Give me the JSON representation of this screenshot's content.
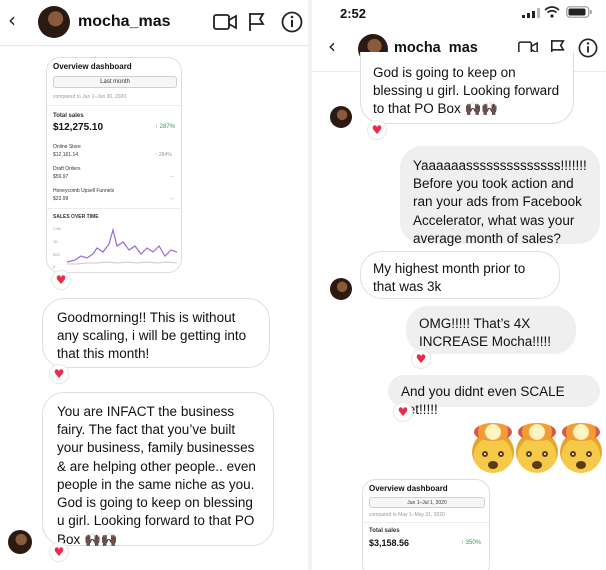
{
  "left": {
    "header": {
      "username": "mocha_mas",
      "back_icon": "chevron-left-icon",
      "icons": [
        "video-call-icon",
        "flag-icon",
        "info-icon"
      ]
    },
    "dashboard_card": {
      "title": "Overview dashboard",
      "date_button": "Last month",
      "compared": "compared to Jun 1–Jun 30, 2020",
      "total_sales_label": "Total sales",
      "total_sales_value": "$12,275.10",
      "total_sales_change": "↑ 287%",
      "rows": [
        {
          "label": "Online Store",
          "value": "$12,161.14",
          "change": "↑ 284%"
        },
        {
          "label": "Draft Orders",
          "value": "$59.97",
          "change": "–"
        },
        {
          "label": "Honeycomb Upsell Funnels",
          "value": "$23.99",
          "change": "–"
        }
      ],
      "chart_title": "SALES OVER TIME",
      "chart_ticks": [
        "1.6K",
        "1K",
        "500",
        "0"
      ]
    },
    "messages": [
      {
        "text": "Goodmorning!! This is without any scaling, i will be getting into that this month!"
      },
      {
        "text": "You are INFACT the business fairy. The fact that you’ve built your business, family businesses & are helping other people.. even people in the same niche as you. God is going to keep on blessing u girl. Looking forward to that PO Box 🙌🏿🙌🏿"
      }
    ]
  },
  "right": {
    "status": {
      "time": "2:52"
    },
    "header": {
      "username": "mocha_mas"
    },
    "messages": [
      {
        "text": "God is going to keep on blessing u girl. Looking forward to that PO Box 🙌🏿🙌🏿"
      },
      {
        "text": "Yaaaaaassssssssssssss!!!!!!! Before you took action and ran your ads from Facebook Accelerator, what was your average month of sales?"
      },
      {
        "text": "My highest month prior to that was 3k"
      },
      {
        "text": "OMG!!!!! That’s 4X INCREASE Mocha!!!!!"
      },
      {
        "text": "And you didnt even SCALE yet!!!!!"
      }
    ],
    "dashboard_card": {
      "title": "Overview dashboard",
      "date_button": "Jun 1–Jul 1, 2020",
      "compared": "compared to May 1–May 31, 2020",
      "total_sales_label": "Total sales",
      "total_sales_value": "$3,158.56",
      "total_sales_change": "↑ 350%"
    }
  },
  "colors": {
    "heart": "#ed2a4a",
    "sent_bubble": "#efefef",
    "growth_green": "#2e9d5a",
    "chart_line": "#9b6ad6"
  }
}
